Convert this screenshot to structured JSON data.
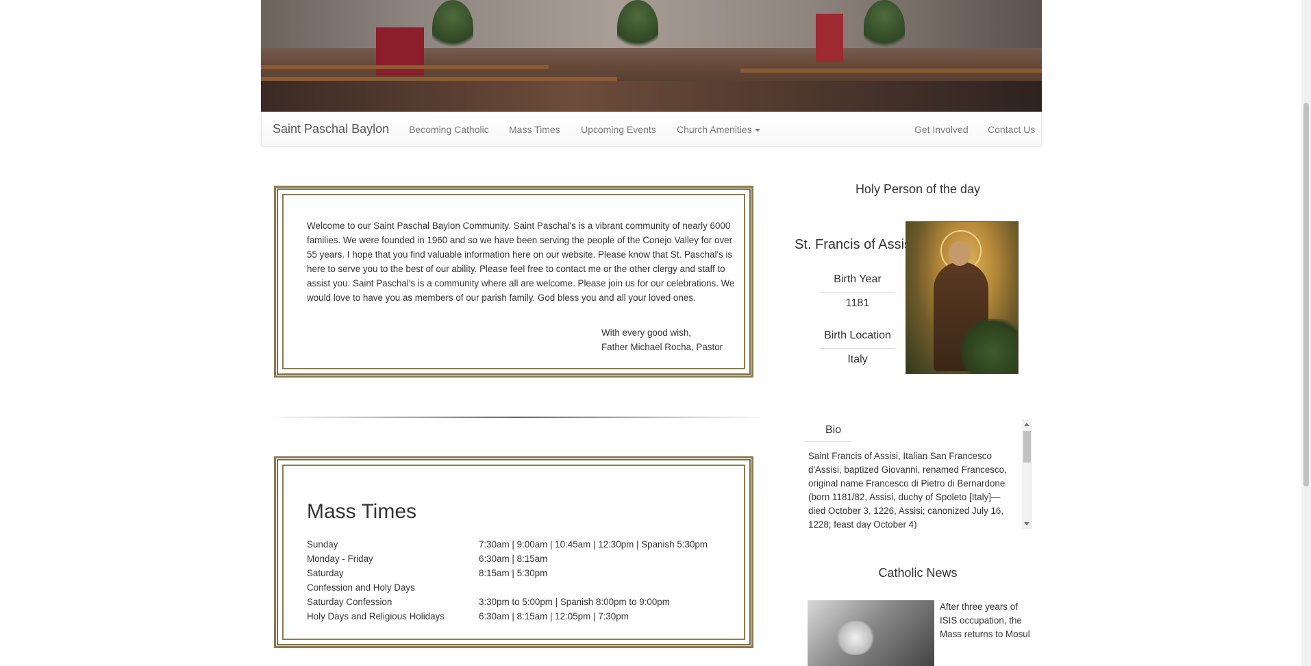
{
  "nav": {
    "brand": "Saint Paschal Baylon",
    "links": [
      "Becoming Catholic",
      "Mass Times",
      "Upcoming Events",
      "Church Amenities"
    ],
    "right_links": [
      "Get Involved",
      "Contact Us"
    ]
  },
  "welcome": {
    "text": "Welcome to our Saint Paschal Baylon Community. Saint Paschal's is a vibrant community of nearly 6000 families. We were founded in 1960 and so we have been serving the people of the Conejo Valley for over 55 years. I hope that you find valuable information here on our website. Please know that St. Paschal's is here to serve you to the best of our ability. Please feel free to contact me or the other clergy and staff to assist you. Saint Paschal's is a community where all are welcome. Please join us for our celebrations. We would love to have you as members of our parish family. God bless you and all your loved ones.",
    "signoff_line1": "With every good wish,",
    "signoff_line2": "Father Michael Rocha, Pastor"
  },
  "mass_times": {
    "title": "Mass Times",
    "rows": [
      {
        "day": "Sunday",
        "time": "7:30am | 9:00am | 10:45am | 12:30pm | Spanish 5:30pm"
      },
      {
        "day": "Monday - Friday",
        "time": "6:30am | 8:15am"
      },
      {
        "day": "Saturday",
        "time": "8:15am | 5:30pm"
      },
      {
        "day": "Confession and Holy Days",
        "time": ""
      },
      {
        "day": "Saturday Confession",
        "time": "3:30pm to 5:00pm | Spanish 8:00pm to 9:00pm"
      },
      {
        "day": "Holy Days and Religious Holidays",
        "time": "6:30am | 8:15am | 12:05pm | 7:30pm"
      }
    ]
  },
  "holy_person": {
    "heading": "Holy Person of the day",
    "name": "St. Francis of Assisi",
    "birth_year_label": "Birth Year",
    "birth_year": "1181",
    "birth_location_label": "Birth Location",
    "birth_location": "Italy",
    "bio_title": "Bio",
    "bio_text": "Saint Francis of Assisi, Italian San Francesco d'Assisi, baptized Giovanni, renamed Francesco, original name Francesco di Pietro di Bernardone (born 1181/82, Assisi, duchy of Spoleto [Italy]—died October 3, 1226, Assisi; canonized July 16, 1228; feast day October 4)"
  },
  "news": {
    "heading": "Catholic News",
    "item_text": "After three years of ISIS occupation, the Mass returns to Mosul"
  }
}
